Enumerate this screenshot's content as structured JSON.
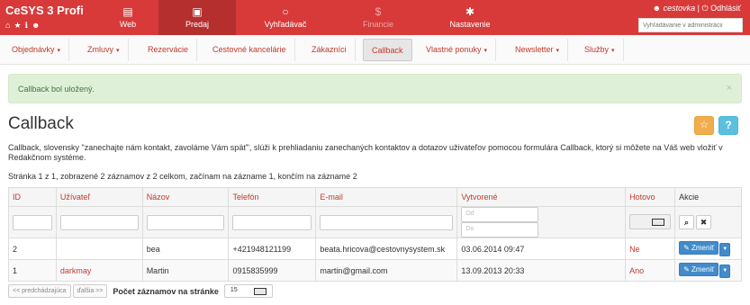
{
  "app": {
    "title": "CeSYS 3 Profi"
  },
  "brand_icons": [
    "home-icon",
    "star-icon",
    "info-icon",
    "user-icon"
  ],
  "topnav": [
    {
      "label": "Web",
      "icon": "web-icon",
      "glyph": "▤"
    },
    {
      "label": "Predaj",
      "icon": "briefcase-icon",
      "glyph": "▣"
    },
    {
      "label": "Vyhľadávač",
      "icon": "search-icon",
      "glyph": "○"
    },
    {
      "label": "Financie",
      "icon": "dollar-icon",
      "glyph": "$"
    },
    {
      "label": "Nastavenie",
      "icon": "gear-icon",
      "glyph": "✱"
    }
  ],
  "user": {
    "name": "cestovka",
    "separator": "|",
    "logout": "Odhlásiť"
  },
  "search": {
    "placeholder": "Vyhľadávanie v administrácii"
  },
  "subnav": [
    {
      "label": "Objednávky",
      "dropdown": true
    },
    {
      "label": "Zmluvy",
      "dropdown": true
    },
    {
      "label": "Rezervácie",
      "dropdown": false
    },
    {
      "label": "Cestovné kancelárie",
      "dropdown": false
    },
    {
      "label": "Zákazníci",
      "dropdown": false
    },
    {
      "label": "Callback",
      "dropdown": false
    },
    {
      "label": "Vlastné ponuky",
      "dropdown": true
    },
    {
      "label": "Newsletter",
      "dropdown": true
    },
    {
      "label": "Služby",
      "dropdown": true
    }
  ],
  "alert": {
    "text": "Callback bol uložený.",
    "close": "×"
  },
  "page": {
    "title": "Callback",
    "star_glyph": "☆",
    "help_glyph": "?",
    "description": "Callback, slovensky \"zanechajte nám kontakt, zavoláme Vám späť\", slúži k prehliadaniu zanechaných kontaktov a dotazov uživateľov pomocou formulára Callback, ktorý si môžete na Váš web vložiť v Redakčnom systéme.",
    "page_info": "Stránka 1 z 1, zobrazené 2 záznamov z 2 celkom, začínam na zázname 1, končím na zázname 2"
  },
  "table": {
    "headers": [
      "ID",
      "Užívateľ",
      "Názov",
      "Telefón",
      "E-mail",
      "Vytvorené",
      "Hotovo",
      "Akcie"
    ],
    "filters": {
      "date_from": "Od",
      "date_to": "Do",
      "search_glyph": "🔍",
      "clear_glyph": "✖"
    },
    "rows": [
      {
        "id": "2",
        "user": "",
        "name": "bea",
        "phone": "+421948121199",
        "email": "beata.hricova@cestovnysystem.sk",
        "created": "03.06.2014 09:47",
        "done": "Ne",
        "edit": "Zmeniť"
      },
      {
        "id": "1",
        "user": "darkmay",
        "name": "Martin",
        "phone": "0915835999",
        "email": "martin@gmail.com",
        "created": "13.09.2013 20:33",
        "done": "Ano",
        "edit": "Zmeniť"
      }
    ]
  },
  "pager": {
    "prev": "<< predchádzajúca",
    "next": "ďalšia >>",
    "per_page_label": "Počet záznamov na stránke",
    "per_page_value": "15"
  }
}
